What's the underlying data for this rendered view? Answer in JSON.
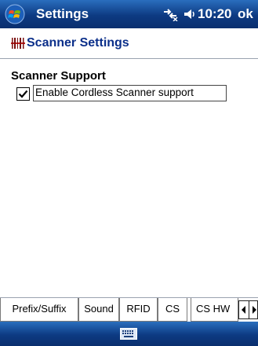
{
  "window": {
    "title": "Settings",
    "time": "10:20",
    "ok_label": "ok",
    "bar_color": "#0d3a82"
  },
  "header": {
    "title": "Scanner Settings",
    "title_color": "#0b2f8a"
  },
  "section": {
    "title": "Scanner Support"
  },
  "checkbox": {
    "label": "Enable Cordless Scanner support",
    "checked": true
  },
  "tabs": [
    {
      "label": "Prefix/Suffix",
      "active": false
    },
    {
      "label": "Sound",
      "active": false
    },
    {
      "label": "RFID",
      "active": false
    },
    {
      "label": "CS",
      "active": true
    },
    {
      "label": "CS HW",
      "active": false
    }
  ],
  "icons": [
    "start-windows-icon",
    "connectivity-icon",
    "speaker-icon",
    "scanner-barcode-icon",
    "keyboard-icon",
    "arrow-left-icon",
    "arrow-right-icon"
  ]
}
